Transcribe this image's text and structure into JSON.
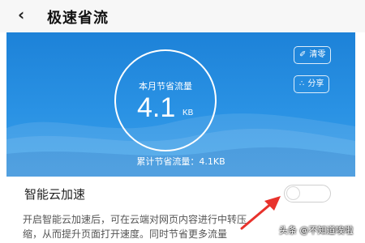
{
  "header": {
    "back_icon": "chevron-left-icon",
    "title": "极速省流"
  },
  "hero": {
    "gauge_label": "本月节省流量",
    "gauge_value": "4.1",
    "gauge_unit": "KB",
    "clear_label": "清零",
    "share_label": "分享",
    "total_text": "累计节省流量：4.1KB",
    "background_color": "#1d82d8"
  },
  "cloud_accel": {
    "label": "智能云加速",
    "toggle_state": "off"
  },
  "description": {
    "line1": "开启智能云加速后，可在云端对网页内容进行中转压",
    "line2": "缩，从而提升页面打开速度。同时节省更多流量"
  },
  "watermark": "头条 @不知道唉啦",
  "annotation": {
    "arrow_color": "#e8322c"
  }
}
